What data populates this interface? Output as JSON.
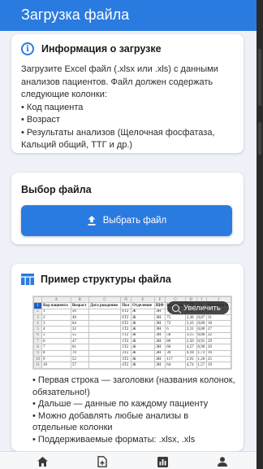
{
  "app": {
    "title": "Загрузка файла"
  },
  "info_card": {
    "title": "Информация о загрузке",
    "text": "Загрузите Excel файл (.xlsx или .xls) с данными анализов пациентов. Файл должен содержать следующие колонки:",
    "items": [
      "• Код пациента",
      "• Возраст",
      "• Результаты анализов (Щелочная фосфатаза, Кальций общий, ТТГ и др.)"
    ]
  },
  "file_card": {
    "title": "Выбор файла",
    "button_label": "Выбрать файл"
  },
  "example_card": {
    "title": "Пример структуры файла",
    "zoom_label": "Увеличить",
    "sheet": {
      "col_letters": [
        "A",
        "B",
        "C",
        "D",
        "E",
        "F",
        "G",
        "H",
        "I",
        "J"
      ],
      "header": [
        "Код пациента",
        "Возраст",
        "Дата рождения",
        "Пол",
        "Отделение",
        "ЩФ",
        "Кальций",
        "ТТГ",
        "Т4",
        "Витамин D"
      ],
      "rows": [
        [
          "1",
          "56",
          "",
          "6Т2",
          "Ж",
          "ЭН",
          "72",
          "2,40",
          "0,87",
          "24"
        ],
        [
          "2",
          "49",
          "",
          "6Т2",
          "Ж",
          "ЭН",
          "75",
          "2,38",
          "0,87",
          "31"
        ],
        [
          "3",
          "64",
          "",
          "6Т2",
          "Ж",
          "ЭН",
          "72",
          "3,16",
          "0,80",
          "18"
        ],
        [
          "4",
          "32",
          "",
          "1Т2",
          "Ж",
          "ЭН",
          "6",
          "2,31",
          "0,80",
          "27"
        ],
        [
          "5",
          "55",
          "",
          "1Т2",
          "Ж",
          "ЭН",
          "58",
          "3,15",
          "0,80",
          "22"
        ],
        [
          "6",
          "47",
          "",
          "1Т2",
          "Ж",
          "ЭН",
          "80",
          "2,50",
          "0,91",
          "29"
        ],
        [
          "7",
          "61",
          "",
          "5Т2",
          "Ж",
          "ЭН",
          "60",
          "4,57",
          "0,90",
          "20"
        ],
        [
          "8",
          "70",
          "",
          "3Т2",
          "Ж",
          "ЭН",
          "30",
          "4,18",
          "1,73",
          "16"
        ],
        [
          "9",
          "52",
          "",
          "3Т2",
          "Ж",
          "ЭН",
          "117",
          "2,91",
          "1,20",
          "25"
        ],
        [
          "10",
          "57",
          "",
          "4Т2",
          "Ж",
          "ЭН",
          "64",
          "4,74",
          "1,57",
          "19"
        ]
      ]
    },
    "bullets": [
      "• Первая строка — заголовки (названия колонок, обязательно!)",
      "• Дальше — данные по каждому пациенту",
      "• Можно добавлять любые анализы в отдельные колонки",
      "• Поддерживаемые форматы: .xlsx, .xls"
    ]
  },
  "colors": {
    "accent": "#2a7be0",
    "background": "#eef2f8",
    "card": "#ffffff"
  },
  "bottom_nav": {
    "icons": [
      "home-icon",
      "add-file-icon",
      "analytics-icon",
      "person-icon"
    ]
  }
}
